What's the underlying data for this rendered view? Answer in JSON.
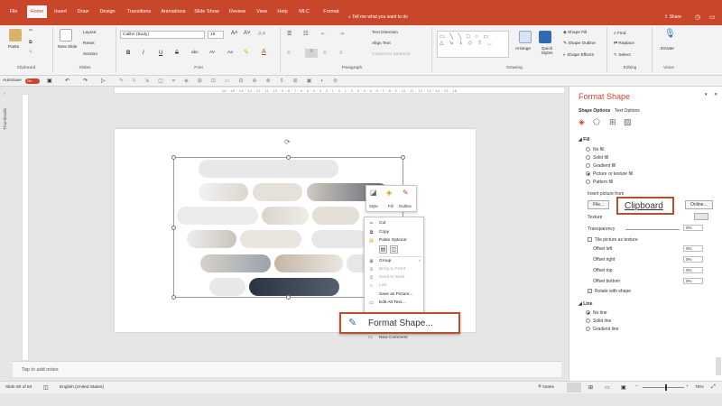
{
  "tabs": [
    "File",
    "Home",
    "Insert",
    "Draw",
    "Design",
    "Transitions",
    "Animations",
    "Slide Show",
    "Review",
    "View",
    "Help",
    "MLC",
    "Format"
  ],
  "active_tab": "Home",
  "tell_me": "Tell me what you want to do",
  "share_label": "Share",
  "ribbon": {
    "clipboard": {
      "paste": "Paste",
      "label": "Clipboard"
    },
    "slides": {
      "new_slide": "New Slide",
      "layout": "Layout",
      "reset": "Reset",
      "section": "Section",
      "label": "Slides"
    },
    "font": {
      "name": "Calibri (Body)",
      "size": "18",
      "bold": "B",
      "italic": "I",
      "underline": "U",
      "strike": "S",
      "shadow": "abc",
      "spacing": "AV",
      "case": "Aa",
      "label": "Font"
    },
    "paragraph": {
      "text_direction": "Text Direction",
      "align_text": "Align Text",
      "smartart": "Convert to SmartArt",
      "label": "Paragraph"
    },
    "drawing": {
      "arrange": "Arrange",
      "quick_styles": "Quick Styles",
      "shape_fill": "Shape Fill",
      "shape_outline": "Shape Outline",
      "shape_effects": "Shape Effects",
      "label": "Drawing"
    },
    "editing": {
      "find": "Find",
      "replace": "Replace",
      "select": "Select",
      "label": "Editing"
    },
    "voice": {
      "dictate": "Dictate",
      "label": "Voice"
    }
  },
  "qat": {
    "autosave": "AutoSave",
    "toggle": "On"
  },
  "ruler_text": "16 · 15 · 14 · 13 · 12 · 11 · 10 · 9 · 8 · 7 · 6 · 5 · 4 · 3 · 2 · 1 · 0 · 1 · 2 · 3 · 4 · 5 · 6 · 7 · 8 · 9 · 10 · 11 · 12 · 13 · 14 · 15 · 16",
  "thumbnails_label": "Thumbnails",
  "notes_placeholder": "Tap to add notes",
  "status": {
    "slide": "Slide 60 of 84",
    "language": "English (United States)",
    "notes": "Notes",
    "zoom": "75%"
  },
  "mini_toolbar": {
    "style": "Style",
    "fill": "Fill",
    "outline": "Outline"
  },
  "context_menu": {
    "cut": "Cut",
    "copy": "Copy",
    "paste_options": "Paste Options:",
    "group": "Group",
    "bring_front": "Bring to Front",
    "send_back": "Send to Back",
    "link": "Link",
    "save_picture": "Save as Picture...",
    "alt_text": "Edit Alt Text...",
    "format_shape": "Format Shape...",
    "new_comment": "New Comment"
  },
  "pane": {
    "title": "Format Shape",
    "tab_shape": "Shape Options",
    "tab_text": "Text Options",
    "fill_header": "Fill",
    "fill_options": [
      "No fill",
      "Solid fill",
      "Gradient fill",
      "Picture or texture fill",
      "Pattern fill"
    ],
    "fill_selected": 3,
    "insert_from": "Insert picture from",
    "file_btn": "File...",
    "clipboard_btn": "Clipboard",
    "online_btn": "Online...",
    "texture": "Texture",
    "transparency": "Transparency",
    "transparency_val": "0%",
    "tile": "Tile picture as texture",
    "offsets": [
      {
        "label": "Offset left",
        "val": "0%"
      },
      {
        "label": "Offset right",
        "val": "0%"
      },
      {
        "label": "Offset top",
        "val": "0%"
      },
      {
        "label": "Offset bottom",
        "val": "0%"
      }
    ],
    "rotate": "Rotate with shape",
    "line_header": "Line",
    "line_options": [
      "No line",
      "Solid line",
      "Gradient line"
    ],
    "line_selected": 0
  },
  "colors": {
    "accent": "#c8472b",
    "callout": "#b5512e"
  }
}
